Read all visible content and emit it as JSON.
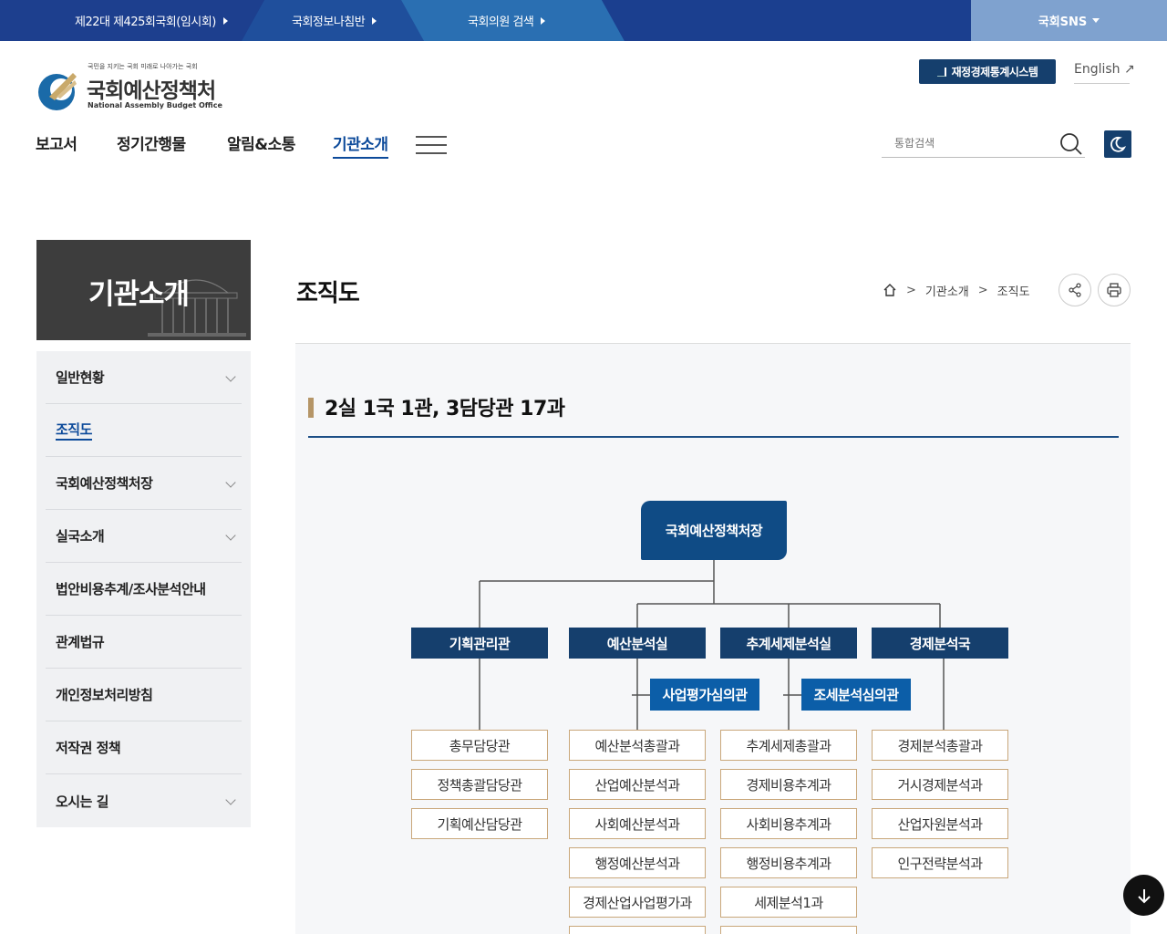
{
  "topbar": {
    "links": [
      "제22대 제425회국회(임시회)",
      "국회정보나침반",
      "국회의원 검색"
    ],
    "sns_label": "국회SNS"
  },
  "logo": {
    "tagline": "국민을 지키는 국회 미래로 나아가는 국회",
    "name": "국회예산정책처",
    "en": "National Assembly Budget Office"
  },
  "header": {
    "stat_button": "재정경제통계시스템",
    "english": "English ↗",
    "gnb": [
      "보고서",
      "정기간행물",
      "알림&소통",
      "기관소개"
    ],
    "search_placeholder": "통합검색"
  },
  "sidebar": {
    "banner_title": "기관소개",
    "items": [
      {
        "label": "일반현황",
        "has_sub": true
      },
      {
        "label": "조직도",
        "has_sub": false,
        "active": true
      },
      {
        "label": "국회예산정책처장",
        "has_sub": true
      },
      {
        "label": "실국소개",
        "has_sub": true
      },
      {
        "label": "법안비용추계/조사분석안내",
        "has_sub": false
      },
      {
        "label": "관계법규",
        "has_sub": false
      },
      {
        "label": "개인정보처리방침",
        "has_sub": false
      },
      {
        "label": "저작권 정책",
        "has_sub": false
      },
      {
        "label": "오시는 길",
        "has_sub": true
      }
    ]
  },
  "main": {
    "title": "조직도",
    "breadcrumb": [
      "기관소개",
      "조직도"
    ],
    "section_title": "2실 1국 1관, 3담당관 17과"
  },
  "org": {
    "head": "국회예산정책처장",
    "departments": [
      "기획관리관",
      "예산분석실",
      "추계세제분석실",
      "경제분석국"
    ],
    "sub_departments": [
      "사업평가심의관",
      "조세분석심의관"
    ],
    "units": [
      [
        "총무담당관",
        "정책총괄담당관",
        "기획예산담당관"
      ],
      [
        "예산분석총괄과",
        "산업예산분석과",
        "사회예산분석과",
        "행정예산분석과",
        "경제산업사업평가과"
      ],
      [
        "추계세제총괄과",
        "경제비용추계과",
        "사회비용추계과",
        "행정비용추계과",
        "세제분석1과"
      ],
      [
        "경제분석총괄과",
        "거시경제분석과",
        "산업자원분석과",
        "인구전략분석과"
      ]
    ]
  }
}
